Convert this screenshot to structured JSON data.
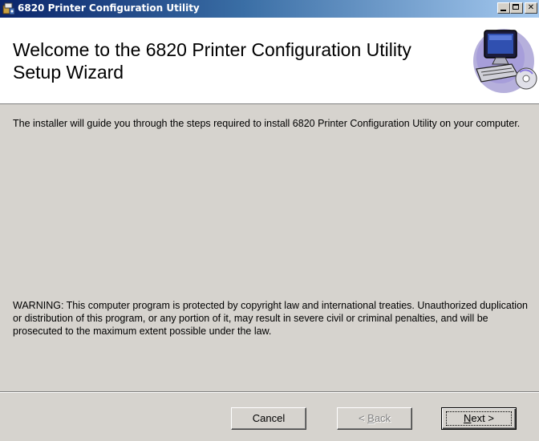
{
  "window": {
    "title": "6820 Printer Configuration Utility",
    "icon": "installer-package-icon",
    "controls": {
      "minimize": "minimize-icon",
      "maximize": "maximize-icon",
      "close": "close-icon"
    }
  },
  "banner": {
    "heading": "Welcome to the 6820 Printer Configuration Utility Setup Wizard",
    "art_icon": "computer-with-disc-icon"
  },
  "content": {
    "intro": "The installer will guide you through the steps required to install 6820 Printer Configuration Utility on your computer.",
    "warning": "WARNING: This computer program is protected by copyright law and international treaties. Unauthorized duplication or distribution of this program, or any portion of it, may result in severe civil or criminal penalties, and will be prosecuted to the maximum extent possible under the law."
  },
  "buttons": {
    "cancel": "Cancel",
    "back_prefix": "< ",
    "back_access_key": "B",
    "back_rest": "ack",
    "next_access_key": "N",
    "next_rest": "ext >",
    "back_enabled": false,
    "next_default": true
  },
  "colors": {
    "titlebar_start": "#0a246a",
    "titlebar_end": "#a6caf0",
    "dialog_face": "#d6d3ce",
    "banner_bg": "#ffffff",
    "disabled_text": "#808080"
  }
}
